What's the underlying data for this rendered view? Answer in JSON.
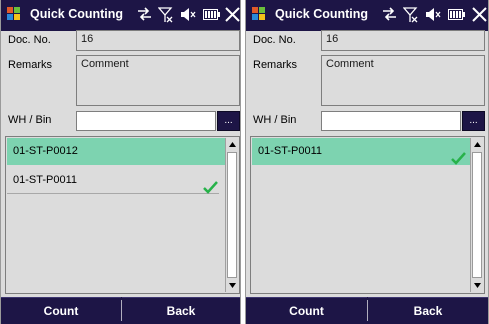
{
  "screens": [
    {
      "title": "Quick Counting",
      "doc_no_label": "Doc. No.",
      "doc_no_value": "16",
      "remarks_label": "Remarks",
      "remarks_value": "Comment",
      "wh_bin_label": "WH / Bin",
      "wh_bin_value": "",
      "browse_label": "...",
      "list_items": [
        {
          "label": "01-ST-P0012",
          "selected": true,
          "checked": false
        },
        {
          "label": "01-ST-P0011",
          "selected": false,
          "checked": true
        }
      ],
      "count_button": "Count",
      "back_button": "Back"
    },
    {
      "title": "Quick Counting",
      "doc_no_label": "Doc. No.",
      "doc_no_value": "16",
      "remarks_label": "Remarks",
      "remarks_value": "Comment",
      "wh_bin_label": "WH / Bin",
      "wh_bin_value": "",
      "browse_label": "...",
      "list_items": [
        {
          "label": "01-ST-P0011",
          "selected": true,
          "checked": true
        }
      ],
      "count_button": "Count",
      "back_button": "Back"
    }
  ],
  "colors": {
    "titlebar": "#1d1546",
    "selected_row": "#7dd3b0",
    "check": "#27b24a",
    "background": "#dcdcdc"
  },
  "icons": [
    "windows-logo-icon",
    "connectivity-icon",
    "signal-off-icon",
    "volume-mute-icon",
    "battery-icon",
    "close-icon",
    "checkmark-icon",
    "scroll-up-icon",
    "scroll-down-icon"
  ]
}
